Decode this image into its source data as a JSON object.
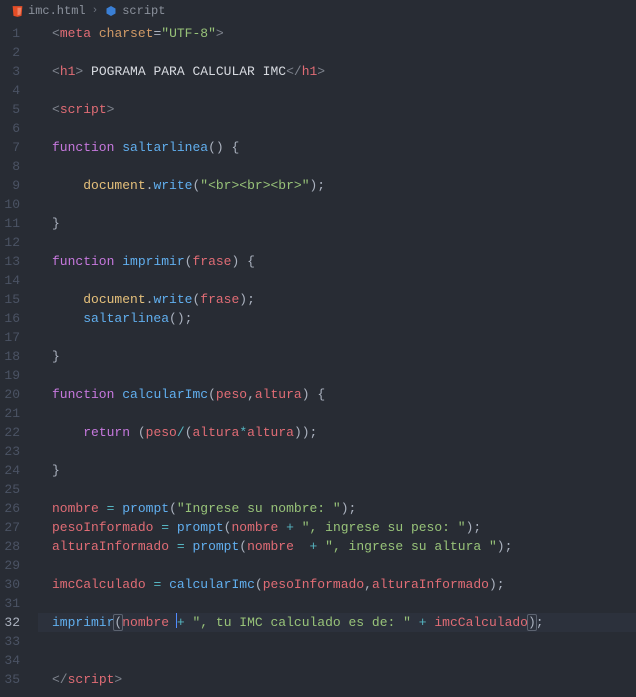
{
  "breadcrumb": {
    "file": "imc.html",
    "sub": "script"
  },
  "icons": {
    "html5": "html5-file-icon",
    "cube": "script-cube-icon",
    "chevron": "›"
  },
  "editor": {
    "active_line": 32,
    "line_count": 35
  },
  "code_lines": [
    "<meta charset=\"UTF-8\">",
    "",
    "<h1> POGRAMA PARA CALCULAR IMC</h1>",
    "",
    "<script>",
    "",
    "function saltarlinea() {",
    "",
    "    document.write(\"<br><br><br>\");",
    "",
    "}",
    "",
    "function imprimir(frase) {",
    "",
    "    document.write(frase);",
    "    saltarlinea();",
    "",
    "}",
    "",
    "function calcularImc(peso,altura) {",
    "",
    "    return (peso/(altura*altura));",
    "",
    "}",
    "",
    "nombre = prompt(\"Ingrese su nombre: \");",
    "pesoInformado = prompt(nombre + \", ingrese su peso: \");",
    "alturaInformado = prompt(nombre  + \", ingrese su altura \");",
    "",
    "imcCalculado = calcularImc(pesoInformado,alturaInformado);",
    "",
    "imprimir(nombre + \", tu IMC calculado es de: \" + imcCalculado);",
    "",
    "",
    "</script>"
  ]
}
